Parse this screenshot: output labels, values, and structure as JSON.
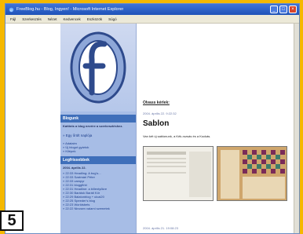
{
  "window": {
    "title": "FreeBlog.hu - Blog, Ingyen! - Microsoft Internet Explorer",
    "menu": [
      "Fájl",
      "Szerkesztés",
      "Nézet",
      "Kedvencek",
      "Eszközök",
      "Súgó"
    ]
  },
  "sidebar": {
    "section1_title": "Blogunk",
    "section1_text": "Kattints a blog nevére a szerkesztéshez.",
    "blog_link": "» Egy őrült naplója",
    "links": [
      "» Adataim",
      "» Új blogot gyártok",
      "» Kilépek"
    ],
    "section2_title": "Legfrissebbek",
    "date_heading": "2004. április 22.",
    "recent": [
      "» 22:33 Headling: A bug's...",
      "» 22:33 Szatmári Péter",
      "» 22:33 vampyr",
      "» 22:31 bloggfirkt",
      "» 22:31 Headline: a billentyűkre",
      "» 22:30 Barátok Baráti Kör",
      "» 22:29 Balatonblog + ulcai20",
      "» 22:25 Speeder's blog",
      "» 22:23 Worldsbets",
      "» 22:22 Nincsen valami szemetek"
    ]
  },
  "main": {
    "heading": "Olvass kérlek:",
    "date": "2004. április 22. 9:22:32",
    "post_title": "Sablon",
    "post_text": "Van két új sablonunk, a Kék-rozsás és a Kockás.",
    "date2": "2004. április 21. 19:08:23"
  },
  "badge": "5",
  "colors": {
    "page_bg": "#f5b800",
    "sidebar_bg": "#a7bde6",
    "sidebar_head": "#3f6fba"
  }
}
